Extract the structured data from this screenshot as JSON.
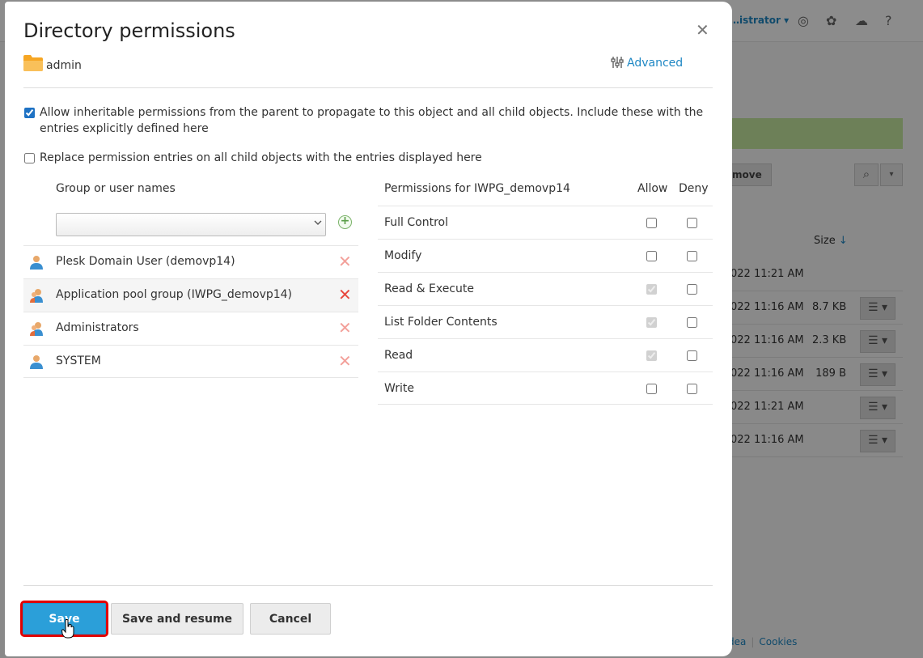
{
  "background": {
    "user_menu": "…istrator ▾",
    "move_button": "move",
    "size_header": "Size",
    "size_sort_arrow": "↓",
    "rows": [
      {
        "date": "022 11:21 AM",
        "size": ""
      },
      {
        "date": "022 11:16 AM",
        "size": "8.7 KB"
      },
      {
        "date": "022 11:16 AM",
        "size": "2.3 KB"
      },
      {
        "date": "022 11:16 AM",
        "size": "189 B"
      },
      {
        "date": "022 11:21 AM",
        "size": ""
      },
      {
        "date": "022 11:16 AM",
        "size": ""
      }
    ],
    "footer": {
      "idea": "dea",
      "cookies": "Cookies"
    }
  },
  "dialog": {
    "title": "Directory permissions",
    "close_icon": "close-icon",
    "folder": {
      "icon": "folder-icon",
      "name": "admin"
    },
    "advanced_label": "Advanced",
    "options": [
      {
        "checked": true,
        "label": "Allow inheritable permissions from the parent to propagate to this object and all child objects. Include these with the entries explicitly defined here"
      },
      {
        "checked": false,
        "label": "Replace permission entries on all child objects with the entries displayed here"
      }
    ],
    "users_header": "Group or user names",
    "user_select": {
      "value": ""
    },
    "users": [
      {
        "name": "Plesk Domain User (demovp14)",
        "icon": "user-icon",
        "selected": false
      },
      {
        "name": "Application pool group (IWPG_demovp14)",
        "icon": "group-icon",
        "selected": true
      },
      {
        "name": "Administrators",
        "icon": "group-icon",
        "selected": false
      },
      {
        "name": "SYSTEM",
        "icon": "user-icon",
        "selected": false
      }
    ],
    "permissions_header": "Permissions for IWPG_demovp14",
    "allow_header": "Allow",
    "deny_header": "Deny",
    "permissions": [
      {
        "name": "Full Control",
        "allow": false,
        "allow_disabled": false,
        "deny": false
      },
      {
        "name": "Modify",
        "allow": false,
        "allow_disabled": false,
        "deny": false
      },
      {
        "name": "Read & Execute",
        "allow": true,
        "allow_disabled": true,
        "deny": false
      },
      {
        "name": "List Folder Contents",
        "allow": true,
        "allow_disabled": true,
        "deny": false
      },
      {
        "name": "Read",
        "allow": true,
        "allow_disabled": true,
        "deny": false
      },
      {
        "name": "Write",
        "allow": false,
        "allow_disabled": false,
        "deny": false
      }
    ],
    "buttons": {
      "save": "Save",
      "save_resume": "Save and resume",
      "cancel": "Cancel"
    },
    "accent_color": "#2b9fd9",
    "highlight_color": "#e00000"
  }
}
